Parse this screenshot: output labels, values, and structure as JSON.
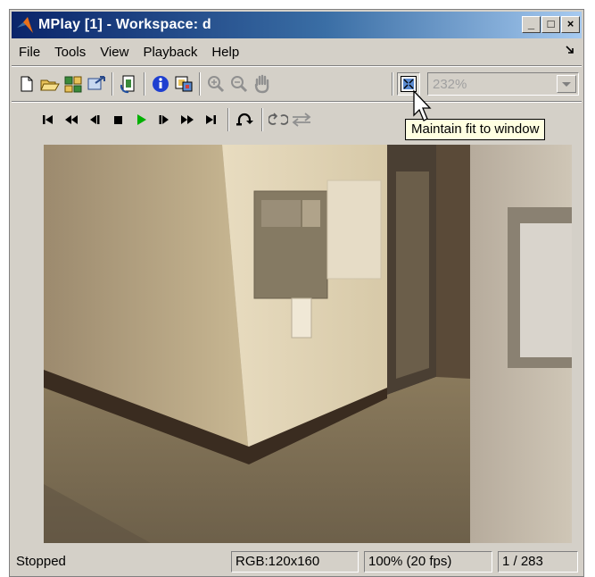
{
  "window": {
    "title": "MPlay [1] - Workspace: d",
    "caption_buttons": [
      "_",
      "□",
      "×"
    ]
  },
  "menu": {
    "items": [
      "File",
      "Tools",
      "View",
      "Playback",
      "Help"
    ],
    "overflow_icon": "dock-arrow-icon"
  },
  "toolbar1": {
    "buttons": [
      "new-icon",
      "open-icon",
      "import-workspace-icon",
      "export-icon",
      "refresh-source-icon",
      "info-icon",
      "colormap-icon",
      "zoom-in-icon",
      "zoom-out-icon",
      "pan-hand-icon",
      "fit-to-window-icon"
    ],
    "zoom_value": "232%"
  },
  "toolbar2": {
    "buttons": [
      "go-to-first-icon",
      "rewind-icon",
      "step-back-icon",
      "stop-icon",
      "play-icon",
      "step-forward-icon",
      "fast-forward-icon",
      "go-to-last-icon",
      "jump-to-icon",
      "auto-reverse-icon",
      "forward-backward-icon"
    ],
    "play_color": "#00b000"
  },
  "tooltip": {
    "text": "Maintain fit to window"
  },
  "status": {
    "state": "Stopped",
    "format": "RGB:120x160",
    "rate": "100% (20 fps)",
    "frame": "1 / 283"
  }
}
